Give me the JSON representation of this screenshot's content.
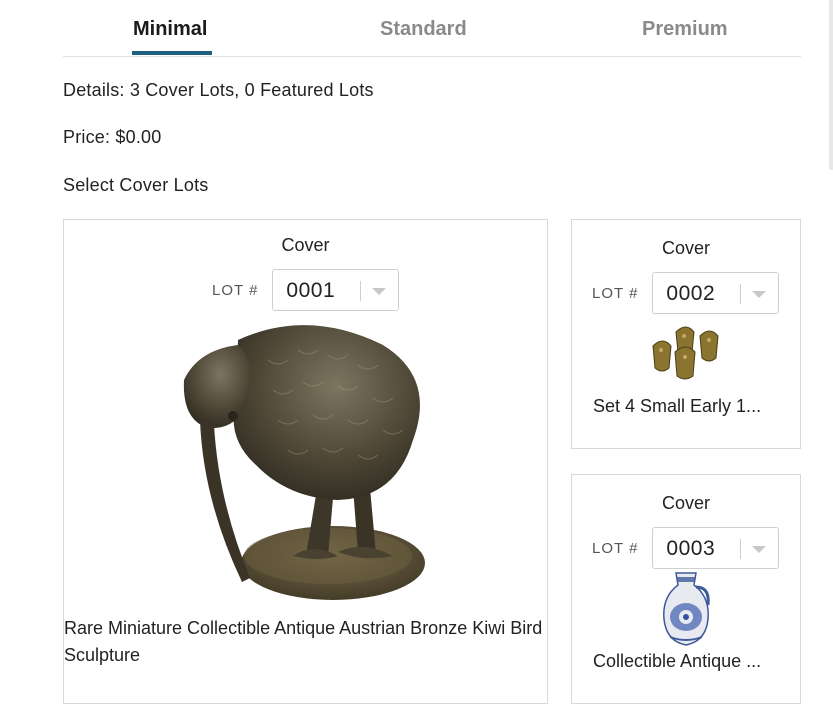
{
  "tabs": [
    {
      "label": "Minimal",
      "active": true
    },
    {
      "label": "Standard",
      "active": false
    },
    {
      "label": "Premium",
      "active": false
    }
  ],
  "summary": {
    "details": "Details: 3 Cover Lots, 0 Featured Lots",
    "price": "Price: $0.00",
    "select_title": "Select Cover Lots"
  },
  "lots": [
    {
      "label": "Cover",
      "lot_label": "LOT #",
      "lot_value": "0001",
      "image": "kiwi-bird-sculpture-image",
      "title": "Rare Miniature Collectible Antique Austrian Bronze Kiwi Bird Sculpture"
    },
    {
      "label": "Cover",
      "lot_label": "LOT #",
      "lot_value": "0002",
      "image": "brass-paw-feet-image",
      "title": "Set 4 Small Early 1..."
    },
    {
      "label": "Cover",
      "lot_label": "LOT #",
      "lot_value": "0003",
      "image": "blue-white-stoneware-jug-image",
      "title": "Collectible Antique ..."
    }
  ],
  "icons": {
    "dropdown": "chevron-down-icon"
  },
  "colors": {
    "accent": "#1f5f7f",
    "inactive_tab": "#8a8a8a"
  }
}
